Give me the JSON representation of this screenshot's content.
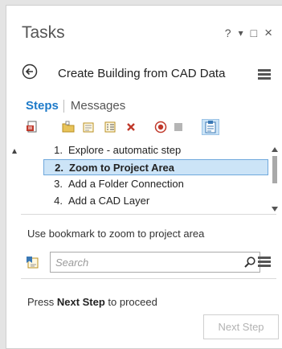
{
  "pane": {
    "title": "Tasks",
    "controls": {
      "help": "?",
      "dropdown": "▾",
      "restore": "□",
      "close": "×"
    }
  },
  "task": {
    "name": "Create Building from CAD Data"
  },
  "tabs": {
    "steps": "Steps",
    "messages": "Messages"
  },
  "toolbar": {
    "icons": [
      "task-report-icon",
      "open-folder-icon",
      "checklist-icon",
      "properties-list-icon",
      "delete-icon",
      "record-icon",
      "stop-icon",
      "clipboard-icon"
    ]
  },
  "steps": [
    {
      "number": "1.",
      "label": "Explore - automatic step",
      "selected": false
    },
    {
      "number": "2.",
      "label": "Zoom to Project Area",
      "selected": true
    },
    {
      "number": "3.",
      "label": "Add a Folder Connection",
      "selected": false
    },
    {
      "number": "4.",
      "label": "Add a CAD Layer",
      "selected": false
    }
  ],
  "instruction": "Use bookmark to zoom to project area",
  "search": {
    "placeholder": "Search"
  },
  "proceed": {
    "prefix": "Press ",
    "bold": "Next Step",
    "suffix": " to proceed"
  },
  "next_button": {
    "label": "Next Step"
  },
  "colors": {
    "accent": "#1d7ac9",
    "selection": "#cce4f7",
    "selection_border": "#6fa8dc",
    "delete": "#c0392b"
  }
}
